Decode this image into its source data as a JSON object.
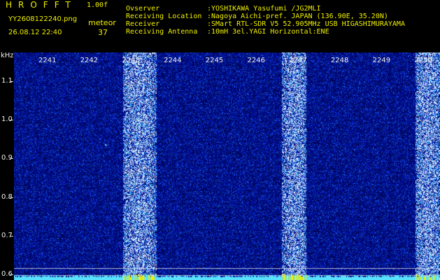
{
  "app": {
    "title": "HROFFT",
    "version": "1.00f",
    "filename": "YY2608122240.png",
    "datetime": "26.08.12 22:40"
  },
  "meteor": {
    "label": "meteor",
    "count": "37"
  },
  "info": [
    {
      "label": "Ovserver",
      "value": ":YOSHIKAWA Yasufumi /JG2MLI"
    },
    {
      "label": "Receiving Location",
      "value": ":Nagoya Aichi-pref. JAPAN (136.90E, 35.20N)"
    },
    {
      "label": "Receiver",
      "value": ":SMart RTL-SDR V5 52.905MHz USB HIGASHIMURAYAMA"
    },
    {
      "label": "Receiving Antenna",
      "value": ":10mH 3el.YAGI Horizontal:ENE"
    }
  ],
  "colors": {
    "header_text": "#f0f000",
    "accent_text": "#3df03d",
    "background": "#000000",
    "axis_text": "#f0f0f0"
  },
  "chart_data": {
    "type": "heatmap",
    "title": "",
    "y_unit": "kHz",
    "x_ticks": [
      "2241",
      "2242",
      "2243",
      "2244",
      "2245",
      "2246",
      "2247",
      "2248",
      "2249",
      "2250"
    ],
    "y_ticks": [
      "1.1",
      "1.0",
      "0.9",
      "0.8",
      "0.7",
      "0.6"
    ],
    "ylim": [
      0.585,
      1.175
    ],
    "xlim": [
      2240.0,
      2250.2
    ],
    "bright_bands": [
      {
        "x_from": 2242.6,
        "x_to": 2243.4
      },
      {
        "x_from": 2246.4,
        "x_to": 2247.0
      },
      {
        "x_from": 2249.6,
        "x_to": 2250.2
      }
    ],
    "reference_lines_khz": [
      0.616,
      0.598
    ],
    "meteor_echo_points": [
      {
        "x": 2242.2,
        "y": 0.935
      },
      {
        "x": 2242.95,
        "y": 0.935
      }
    ]
  }
}
